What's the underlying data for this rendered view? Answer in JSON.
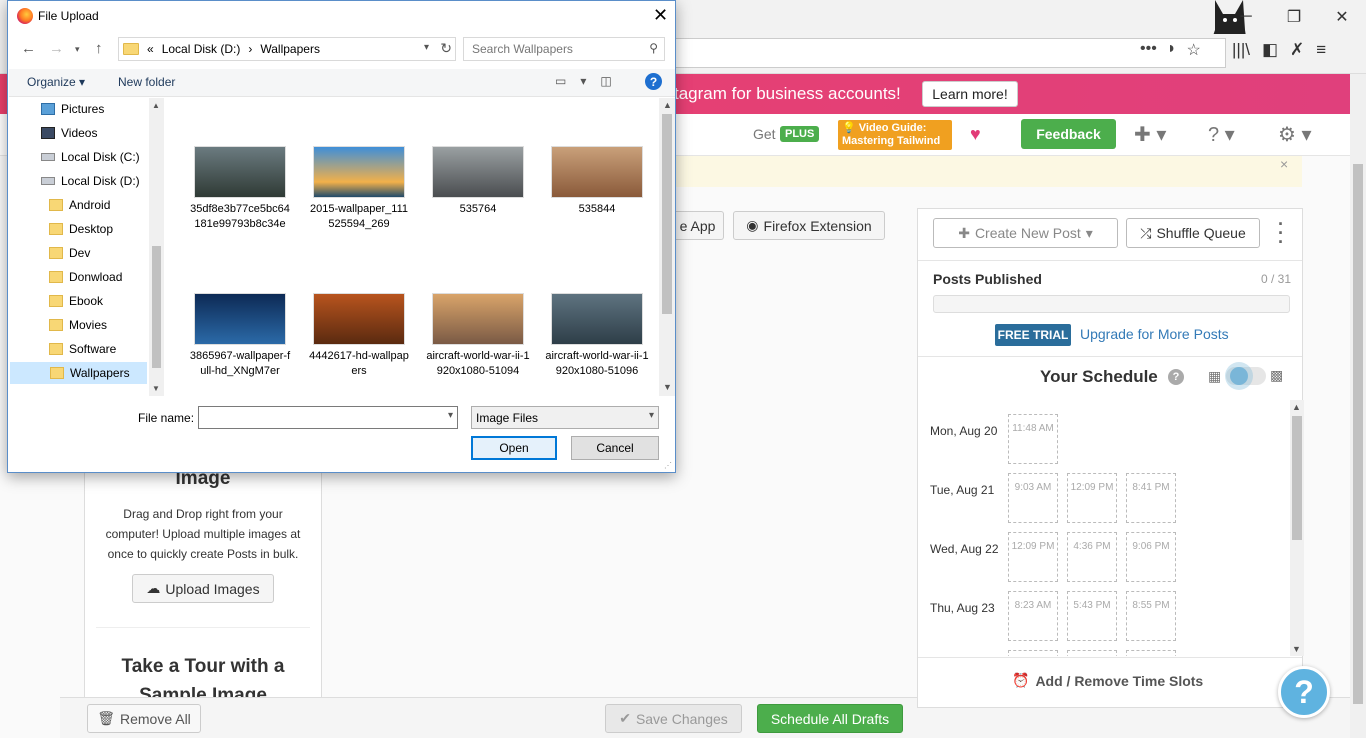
{
  "browser": {
    "icons": {
      "minimize": "─",
      "restore": "❐",
      "close": "✕",
      "more": "•••",
      "pocket": "◗",
      "star": "☆",
      "library": "|||\\",
      "sidebar": "◧",
      "x": "✗",
      "menu": "≡"
    }
  },
  "banner": {
    "text": "tagram for business accounts!",
    "learn_more": "Learn more!"
  },
  "topnav": {
    "get": "Get",
    "plus": "PLUS",
    "video_guide_line1": "💡 Video Guide:",
    "video_guide_line2": "Mastering Tailwind",
    "heart": "♥",
    "feedback": "Feedback",
    "add_icon": "✚ ▾",
    "help_icon": "? ▾",
    "settings_icon": "⚙ ▾"
  },
  "notice": {
    "close": "×"
  },
  "extensions": {
    "app_label": "e App",
    "firefox_label": "Firefox Extension"
  },
  "upload": {
    "title": "Image",
    "description": "Drag and Drop right from your computer! Upload multiple images at once to quickly create Posts in bulk.",
    "button": "Upload Images",
    "tour_title": "Take a Tour with a Sample Image"
  },
  "bottom": {
    "remove_all": "Remove All",
    "save_changes": "Save Changes",
    "schedule_all": "Schedule All Drafts"
  },
  "queue": {
    "create_post": "Create New Post",
    "shuffle": "Shuffle Queue",
    "posts_published": "Posts Published",
    "published_count": "0 / 31",
    "published_fraction": 0,
    "free_trial": "FREE TRIAL",
    "upgrade": "Upgrade for More Posts",
    "your_schedule": "Your Schedule",
    "add_remove_slots": "Add / Remove Time Slots",
    "days": [
      {
        "label": "Mon, Aug 20",
        "slots": [
          "11:48 AM"
        ]
      },
      {
        "label": "Tue, Aug 21",
        "slots": [
          "9:03 AM",
          "12:09 PM",
          "8:41 PM"
        ]
      },
      {
        "label": "Wed, Aug 22",
        "slots": [
          "12:09 PM",
          "4:36 PM",
          "9:06 PM"
        ]
      },
      {
        "label": "Thu, Aug 23",
        "slots": [
          "8:23 AM",
          "5:43 PM",
          "8:55 PM"
        ]
      }
    ]
  },
  "dialog": {
    "title": "File Upload",
    "breadcrumb": [
      "«",
      "Local Disk (D:)",
      "›",
      "Wallpapers"
    ],
    "search_placeholder": "Search Wallpapers",
    "organize": "Organize ▾",
    "new_folder": "New folder",
    "tree": [
      {
        "label": "Pictures",
        "icon": "pictures-icon"
      },
      {
        "label": "Videos",
        "icon": "videos-icon"
      },
      {
        "label": "Local Disk (C:)",
        "icon": "drive-icon"
      },
      {
        "label": "Local Disk (D:)",
        "icon": "drive-icon"
      },
      {
        "label": "Android",
        "icon": "folder-icon"
      },
      {
        "label": "Desktop",
        "icon": "folder-icon"
      },
      {
        "label": "Dev",
        "icon": "folder-icon"
      },
      {
        "label": "Donwload",
        "icon": "folder-icon"
      },
      {
        "label": "Ebook",
        "icon": "folder-icon"
      },
      {
        "label": "Movies",
        "icon": "folder-icon"
      },
      {
        "label": "Software",
        "icon": "folder-icon"
      },
      {
        "label": "Wallpapers",
        "icon": "folder-icon",
        "selected": true
      }
    ],
    "files": [
      {
        "name": "35df8e3b77ce5bc64181e99793b8c34e"
      },
      {
        "name": "2015-wallpaper_111525594_269"
      },
      {
        "name": "535764"
      },
      {
        "name": "535844"
      },
      {
        "name": "3865967-wallpaper-full-hd_XNgM7er"
      },
      {
        "name": "4442617-hd-wallpapers"
      },
      {
        "name": "aircraft-world-war-ii-1920x1080-51094"
      },
      {
        "name": "aircraft-world-war-ii-1920x1080-51096"
      }
    ],
    "file_name_label": "File name:",
    "file_name_value": "",
    "file_type": "Image Files",
    "open": "Open",
    "cancel": "Cancel"
  }
}
